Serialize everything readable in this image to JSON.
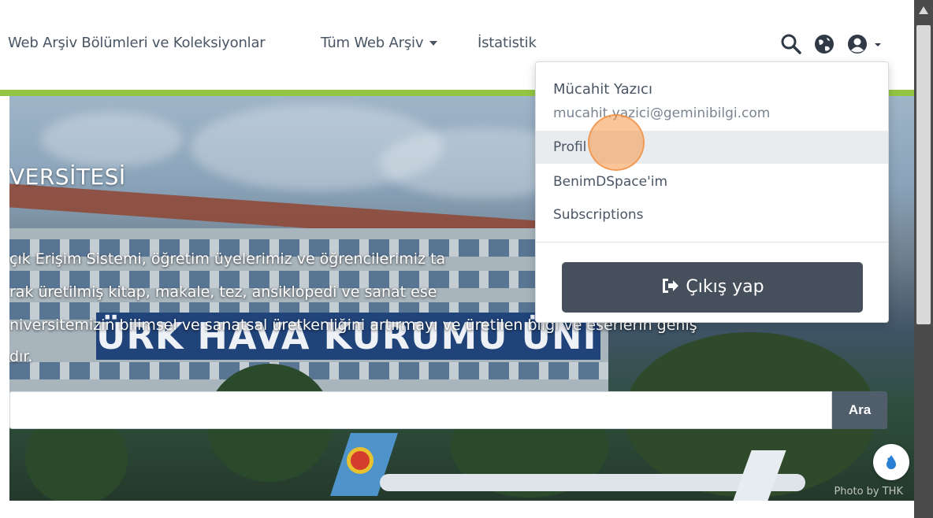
{
  "navbar": {
    "links": [
      {
        "label": "Web Arşiv Bölümleri ve Koleksiyonlar"
      },
      {
        "label": "Tüm Web Arşiv"
      },
      {
        "label": "İstatistik"
      }
    ],
    "icons": [
      "search-icon",
      "globe-icon",
      "user-icon",
      "chevron-down-icon"
    ]
  },
  "hero": {
    "title": "VERSİTESİ",
    "lines": [
      "çık Erişim Sistemi, öğretim üyelerimiz ve öğrencilerimiz ta",
      "rak üretilmiş kitap, makale, tez, ansiklopedi ve sanat ese",
      "niversitemizin bilimsel ve sanatsal üretkenliğini artırmayı ve üretilen bilgi ve eserlerin geniş",
      "dır."
    ],
    "sign_text": "ÜRK HAVA KURUMU ÜNİVERSİTESİ",
    "photo_credit": "Photo by THK"
  },
  "search": {
    "placeholder": "",
    "button_label": "Ara"
  },
  "user_menu": {
    "name": "Mücahit Yazıcı",
    "email": "mucahit.yazici@geminibilgi.com",
    "items": [
      {
        "label": "Profil"
      },
      {
        "label": "BenimDSpace'im"
      },
      {
        "label": "Subscriptions"
      }
    ],
    "logout_label": "Çıkış yap"
  },
  "colors": {
    "accent_green": "#92c642",
    "logout_bg": "#46505c",
    "search_button_bg": "#505d6b",
    "click_indicator": "#f59646"
  }
}
